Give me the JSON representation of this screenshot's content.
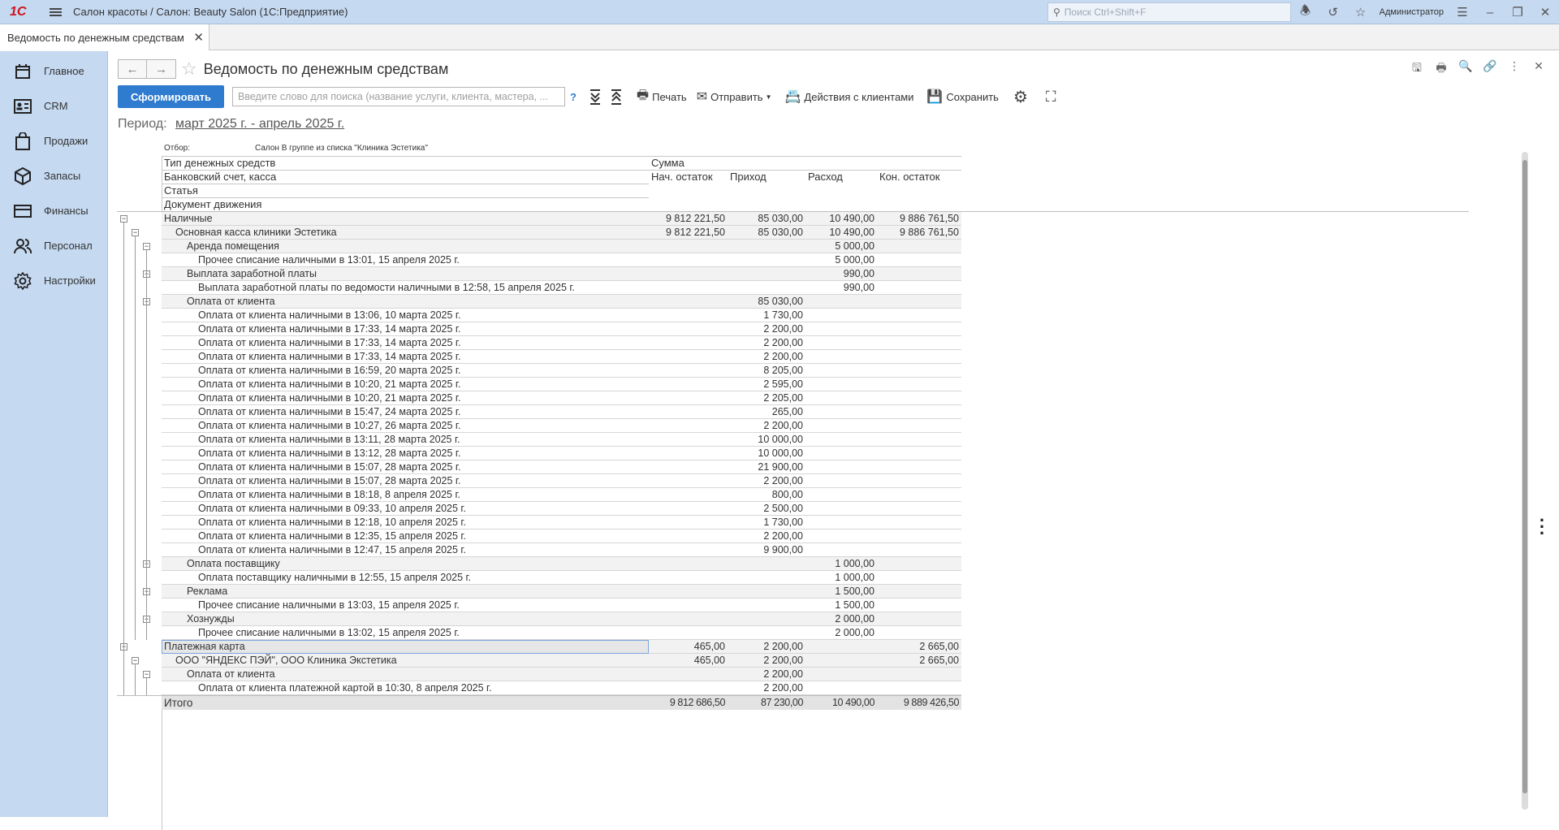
{
  "app": {
    "logo": "1С",
    "title": "Салон красоты / Салон: Beauty Salon  (1С:Предприятие)",
    "search_placeholder": "Поиск Ctrl+Shift+F",
    "user": "Администратор"
  },
  "tab": {
    "label": "Ведомость по денежным средствам"
  },
  "sidebar": {
    "items": [
      {
        "label": "Главное",
        "icon": "calendar-icon"
      },
      {
        "label": "CRM",
        "icon": "contact-card-icon"
      },
      {
        "label": "Продажи",
        "icon": "shopping-bag-icon"
      },
      {
        "label": "Запасы",
        "icon": "box-icon"
      },
      {
        "label": "Финансы",
        "icon": "credit-card-icon"
      },
      {
        "label": "Персонал",
        "icon": "people-icon"
      },
      {
        "label": "Настройки",
        "icon": "gear-icon"
      }
    ]
  },
  "form": {
    "title": "Ведомость по денежным средствам",
    "generate_label": "Сформировать",
    "search_placeholder": "Введите слово для поиска (название услуги, клиента, мастера, ...",
    "help": "?",
    "print_label": "Печать",
    "send_label": "Отправить",
    "client_actions_label": "Действия с клиентами",
    "save_label": "Сохранить",
    "period_label": "Период:",
    "period_value": "март 2025 г. - апрель 2025 г."
  },
  "report": {
    "filter_label": "Отбор:",
    "filter_value": "Салон В группе из списка \"Клиника Эстетика\"",
    "head": {
      "row1": "Тип денежных средств",
      "row1_sum": "Сумма",
      "row2": "Банковский счет, касса",
      "col_open": "Нач. остаток",
      "col_in": "Приход",
      "col_out": "Расход",
      "col_close": "Кон. остаток",
      "row3": "Статья",
      "row4": "Документ движения"
    },
    "rows": [
      {
        "level": 0,
        "text": "Наличные",
        "open": "9 812 221,50",
        "in": "85 030,00",
        "out": "10 490,00",
        "close": "9 886 761,50",
        "group": true
      },
      {
        "level": 1,
        "text": "Основная касса клиники Эстетика",
        "open": "9 812 221,50",
        "in": "85 030,00",
        "out": "10 490,00",
        "close": "9 886 761,50",
        "group": true
      },
      {
        "level": 2,
        "text": "Аренда помещения",
        "open": "",
        "in": "",
        "out": "5 000,00",
        "close": "",
        "group": true
      },
      {
        "level": 3,
        "text": "Прочее списание наличными в 13:01, 15 апреля 2025 г.",
        "open": "",
        "in": "",
        "out": "5 000,00",
        "close": ""
      },
      {
        "level": 2,
        "text": "Выплата заработной платы",
        "open": "",
        "in": "",
        "out": "990,00",
        "close": "",
        "group": true
      },
      {
        "level": 3,
        "text": "Выплата заработной платы по ведомости наличными в 12:58, 15 апреля 2025 г.",
        "open": "",
        "in": "",
        "out": "990,00",
        "close": ""
      },
      {
        "level": 2,
        "text": "Оплата от клиента",
        "open": "",
        "in": "85 030,00",
        "out": "",
        "close": "",
        "group": true
      },
      {
        "level": 3,
        "text": "Оплата от клиента наличными в 13:06, 10 марта 2025 г.",
        "open": "",
        "in": "1 730,00",
        "out": "",
        "close": ""
      },
      {
        "level": 3,
        "text": "Оплата от клиента наличными в 17:33, 14 марта 2025 г.",
        "open": "",
        "in": "2 200,00",
        "out": "",
        "close": ""
      },
      {
        "level": 3,
        "text": "Оплата от клиента наличными в 17:33, 14 марта 2025 г.",
        "open": "",
        "in": "2 200,00",
        "out": "",
        "close": ""
      },
      {
        "level": 3,
        "text": "Оплата от клиента наличными в 17:33, 14 марта 2025 г.",
        "open": "",
        "in": "2 200,00",
        "out": "",
        "close": ""
      },
      {
        "level": 3,
        "text": "Оплата от клиента наличными в 16:59, 20 марта 2025 г.",
        "open": "",
        "in": "8 205,00",
        "out": "",
        "close": ""
      },
      {
        "level": 3,
        "text": "Оплата от клиента наличными в 10:20, 21 марта 2025 г.",
        "open": "",
        "in": "2 595,00",
        "out": "",
        "close": ""
      },
      {
        "level": 3,
        "text": "Оплата от клиента наличными в 10:20, 21 марта 2025 г.",
        "open": "",
        "in": "2 205,00",
        "out": "",
        "close": ""
      },
      {
        "level": 3,
        "text": "Оплата от клиента наличными в 15:47, 24 марта 2025 г.",
        "open": "",
        "in": "265,00",
        "out": "",
        "close": ""
      },
      {
        "level": 3,
        "text": "Оплата от клиента наличными в 10:27, 26 марта 2025 г.",
        "open": "",
        "in": "2 200,00",
        "out": "",
        "close": ""
      },
      {
        "level": 3,
        "text": "Оплата от клиента наличными в 13:11, 28 марта 2025 г.",
        "open": "",
        "in": "10 000,00",
        "out": "",
        "close": ""
      },
      {
        "level": 3,
        "text": "Оплата от клиента наличными в 13:12, 28 марта 2025 г.",
        "open": "",
        "in": "10 000,00",
        "out": "",
        "close": ""
      },
      {
        "level": 3,
        "text": "Оплата от клиента наличными в 15:07, 28 марта 2025 г.",
        "open": "",
        "in": "21 900,00",
        "out": "",
        "close": ""
      },
      {
        "level": 3,
        "text": "Оплата от клиента наличными в 15:07, 28 марта 2025 г.",
        "open": "",
        "in": "2 200,00",
        "out": "",
        "close": ""
      },
      {
        "level": 3,
        "text": "Оплата от клиента наличными в 18:18, 8 апреля 2025 г.",
        "open": "",
        "in": "800,00",
        "out": "",
        "close": ""
      },
      {
        "level": 3,
        "text": "Оплата от клиента наличными в 09:33, 10 апреля 2025 г.",
        "open": "",
        "in": "2 500,00",
        "out": "",
        "close": ""
      },
      {
        "level": 3,
        "text": "Оплата от клиента наличными в 12:18, 10 апреля 2025 г.",
        "open": "",
        "in": "1 730,00",
        "out": "",
        "close": ""
      },
      {
        "level": 3,
        "text": "Оплата от клиента наличными в 12:35, 15 апреля 2025 г.",
        "open": "",
        "in": "2 200,00",
        "out": "",
        "close": ""
      },
      {
        "level": 3,
        "text": "Оплата от клиента наличными в 12:47, 15 апреля 2025 г.",
        "open": "",
        "in": "9 900,00",
        "out": "",
        "close": ""
      },
      {
        "level": 2,
        "text": "Оплата поставщику",
        "open": "",
        "in": "",
        "out": "1 000,00",
        "close": "",
        "group": true
      },
      {
        "level": 3,
        "text": "Оплата поставщику наличными в 12:55, 15 апреля 2025 г.",
        "open": "",
        "in": "",
        "out": "1 000,00",
        "close": ""
      },
      {
        "level": 2,
        "text": "Реклама",
        "open": "",
        "in": "",
        "out": "1 500,00",
        "close": "",
        "group": true
      },
      {
        "level": 3,
        "text": "Прочее списание наличными в 13:03, 15 апреля 2025 г.",
        "open": "",
        "in": "",
        "out": "1 500,00",
        "close": ""
      },
      {
        "level": 2,
        "text": "Хознужды",
        "open": "",
        "in": "",
        "out": "2 000,00",
        "close": "",
        "group": true
      },
      {
        "level": 3,
        "text": "Прочее списание наличными в 13:02, 15 апреля 2025 г.",
        "open": "",
        "in": "",
        "out": "2 000,00",
        "close": ""
      },
      {
        "level": 0,
        "text": "Платежная карта",
        "open": "465,00",
        "in": "2 200,00",
        "out": "",
        "close": "2 665,00",
        "group": true,
        "selected": true
      },
      {
        "level": 1,
        "text": "ООО \"ЯНДЕКС ПЭЙ\", ООО Клиника Экстетика",
        "open": "465,00",
        "in": "2 200,00",
        "out": "",
        "close": "2 665,00",
        "group": true
      },
      {
        "level": 2,
        "text": "Оплата от клиента",
        "open": "",
        "in": "2 200,00",
        "out": "",
        "close": "",
        "group": true
      },
      {
        "level": 3,
        "text": "Оплата от клиента платежной картой в 10:30, 8 апреля 2025 г.",
        "open": "",
        "in": "2 200,00",
        "out": "",
        "close": ""
      }
    ],
    "total": {
      "text": "Итого",
      "open": "9 812 686,50",
      "in": "87 230,00",
      "out": "10 490,00",
      "close": "9 889 426,50"
    }
  }
}
